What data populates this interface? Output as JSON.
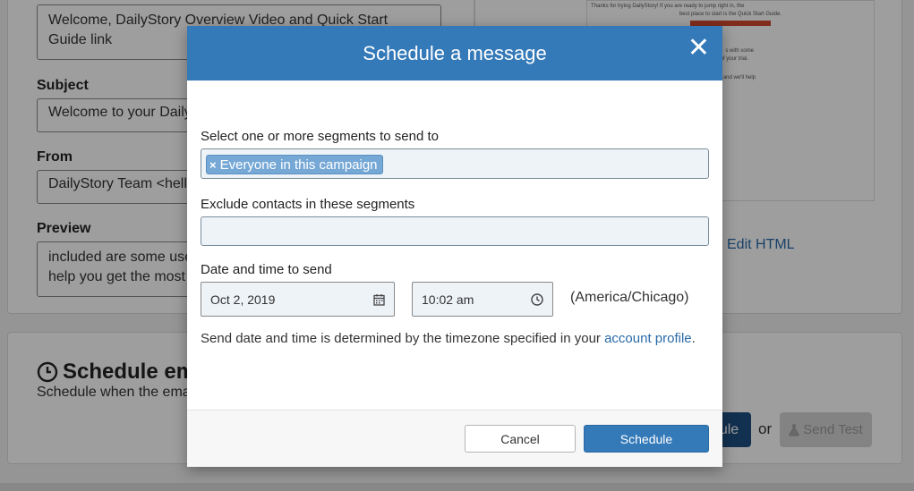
{
  "background": {
    "message_field": "Welcome, DailyStory Overview Video and Quick Start Guide link",
    "subject_label": "Subject",
    "subject_value": "Welcome to your Daily",
    "from_label": "From",
    "from_value": "DailyStory Team <hell",
    "preview_label": "Preview",
    "preview_value_1": "included are some use",
    "preview_value_2": "help you get the most",
    "edit_html_link": "Edit HTML",
    "schedule_section_title": "Schedule em",
    "schedule_section_subtitle": "Schedule when the ema",
    "schedule_button_partial": "ule",
    "or_text": "or",
    "send_test_button": "Send Test",
    "preview_thumb_line1": "Thanks for trying DailyStory! If you are ready to jump right in, the",
    "preview_thumb_line2": "best place to start is the Quick Start Guide.",
    "preview_thumb_line3": "s with some",
    "preview_thumb_line4": "of your trial.",
    "preview_thumb_line5": "and we'll help"
  },
  "modal": {
    "title": "Schedule a message",
    "segments_label": "Select one or more segments to send to",
    "segment_chip": "Everyone in this campaign",
    "exclude_label": "Exclude contacts in these segments",
    "datetime_label": "Date and time to send",
    "date_value": "Oct 2, 2019",
    "time_value": "10:02 am",
    "timezone": "(America/Chicago)",
    "help_text_prefix": "Send date and time is determined by the timezone specified in your ",
    "help_link": "account profile",
    "help_text_suffix": ".",
    "cancel_label": "Cancel",
    "schedule_label": "Schedule"
  },
  "colors": {
    "header": "#3479b8",
    "link": "#2a6aa9",
    "chip": "#76a8d6"
  }
}
